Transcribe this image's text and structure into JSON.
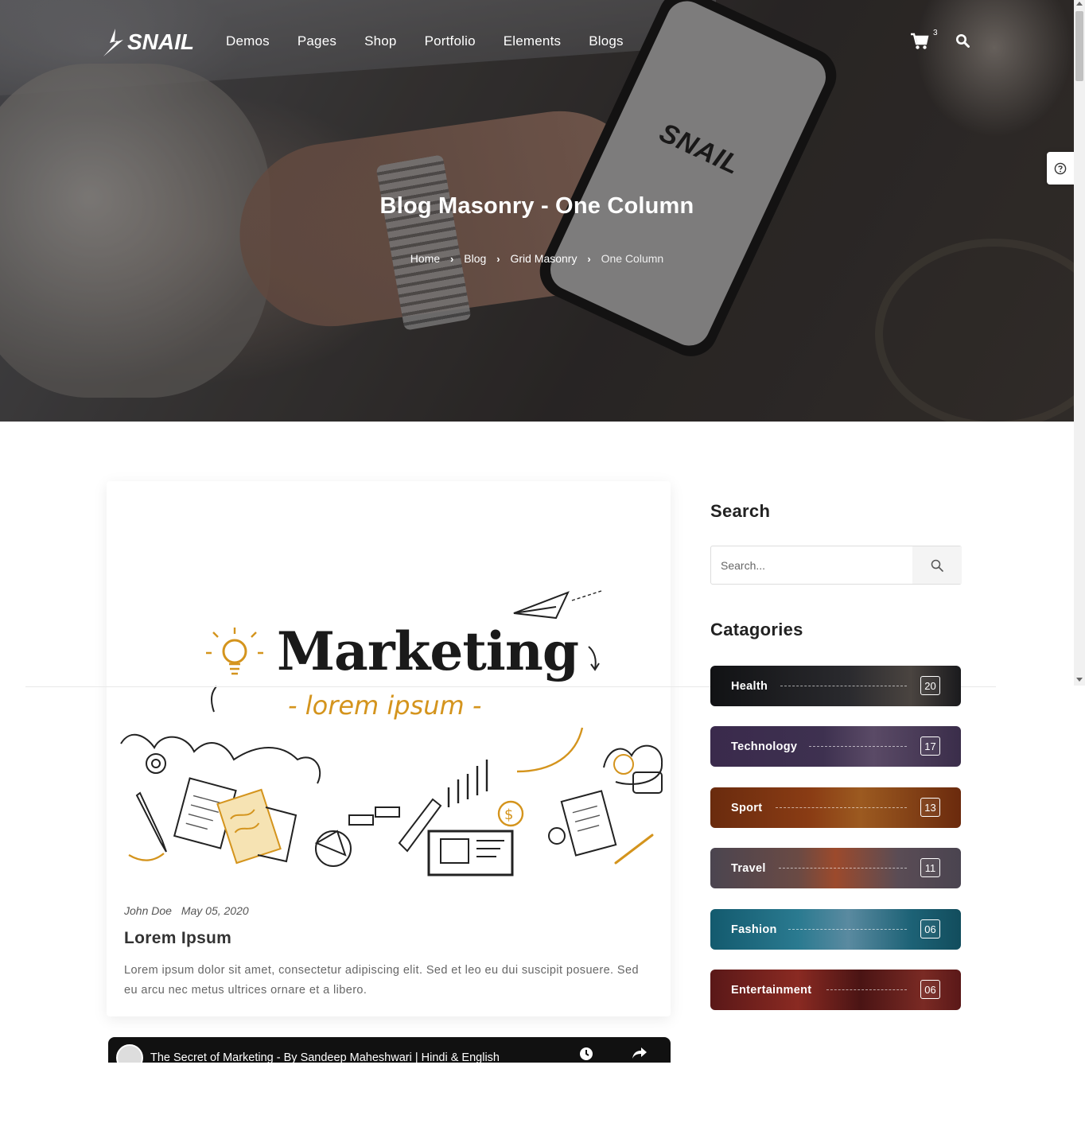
{
  "header": {
    "logo_text": "SNAIL",
    "nav": [
      "Demos",
      "Pages",
      "Shop",
      "Portfolio",
      "Elements",
      "Blogs"
    ],
    "cart_count": "3",
    "cart_icon": "cart-icon",
    "search_icon": "search-icon"
  },
  "hero": {
    "title": "Blog Masonry - One Column",
    "phone_logo": "SNAIL",
    "breadcrumb": [
      "Home",
      "Blog",
      "Grid Masonry",
      "One Column"
    ]
  },
  "post": {
    "image_text": {
      "headline": "Marketing",
      "sub": "- lorem ipsum -"
    },
    "author": "John Doe",
    "date": "May 05, 2020",
    "title": "Lorem Ipsum",
    "excerpt": "Lorem ipsum dolor sit amet, consectetur adipiscing elit. Sed et leo eu dui suscipit posuere. Sed eu arcu nec metus ultrices ornare et a libero."
  },
  "video": {
    "title": "The Secret of Marketing - By Sandeep Maheshwari | Hindi & English"
  },
  "sidebar": {
    "search_heading": "Search",
    "search_placeholder": "Search...",
    "categories_heading": "Catagories",
    "categories": [
      {
        "label": "Health",
        "count": "20",
        "color": "#1c1a1e"
      },
      {
        "label": "Technology",
        "count": "17",
        "color": "#3b2c4a"
      },
      {
        "label": "Sport",
        "count": "13",
        "color": "#6b2c0f"
      },
      {
        "label": "Travel",
        "count": "11",
        "color": "#4c4550"
      },
      {
        "label": "Fashion",
        "count": "06",
        "color": "#1c5b6b"
      },
      {
        "label": "Entertainment",
        "count": "06",
        "color": "#5e1a1a"
      }
    ]
  }
}
